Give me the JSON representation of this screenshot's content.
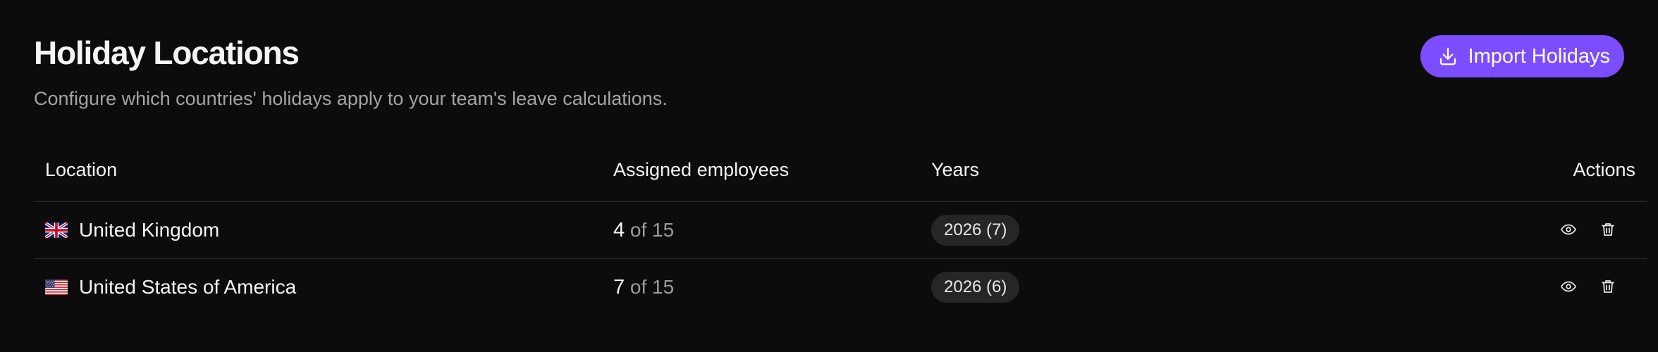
{
  "header": {
    "title": "Holiday Locations",
    "subtitle": "Configure which countries' holidays apply to your team's leave calculations.",
    "import_button_label": "Import Holidays"
  },
  "table": {
    "columns": {
      "location": "Location",
      "assigned": "Assigned employees",
      "years": "Years",
      "actions": "Actions"
    },
    "rows": [
      {
        "flag": "uk-flag-icon",
        "location": "United Kingdom",
        "assigned_count": "4",
        "assigned_total": "of 15",
        "year_badge": "2026 (7)"
      },
      {
        "flag": "us-flag-icon",
        "location": "United States of America",
        "assigned_count": "7",
        "assigned_total": "of 15",
        "year_badge": "2026 (6)"
      }
    ]
  },
  "icons": {
    "view": "eye-icon",
    "delete": "trash-icon",
    "import": "download-icon"
  },
  "colors": {
    "background": "#0c0c0c",
    "accent": "#7c4dff",
    "badge_bg": "#262626",
    "divider": "#2e2e2e",
    "muted_text": "#a3a3a3"
  }
}
